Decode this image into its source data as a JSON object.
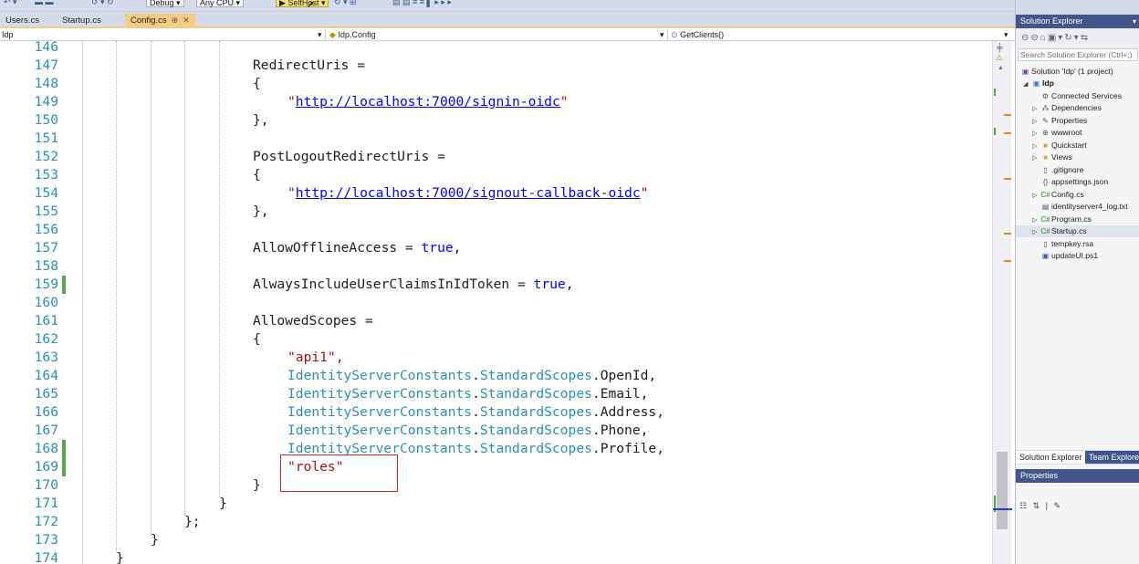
{
  "toolbar": {
    "config": "Debug",
    "platform": "Any CPU",
    "run_target": "SelfHost"
  },
  "tabs": [
    {
      "label": "Users.cs"
    },
    {
      "label": "Startup.cs"
    },
    {
      "label": "Config.cs",
      "pin": "⊕",
      "close": "✕"
    }
  ],
  "navbar": {
    "project": "Idp",
    "type": "Idp.Config",
    "member": "GetClients()"
  },
  "editor": {
    "lines": [
      {
        "n": "146",
        "text": ""
      },
      {
        "n": "147",
        "text": "RedirectUris ="
      },
      {
        "n": "148",
        "text": "{"
      },
      {
        "n": "149",
        "text": "\"http://localhost:7000/signin-oidc\""
      },
      {
        "n": "150",
        "text": "},"
      },
      {
        "n": "151",
        "text": ""
      },
      {
        "n": "152",
        "text": "PostLogoutRedirectUris ="
      },
      {
        "n": "153",
        "text": "{"
      },
      {
        "n": "154",
        "text": "\"http://localhost:7000/signout-callback-oidc\""
      },
      {
        "n": "155",
        "text": "},"
      },
      {
        "n": "156",
        "text": ""
      },
      {
        "n": "157",
        "text": "AllowOfflineAccess = true,"
      },
      {
        "n": "158",
        "text": ""
      },
      {
        "n": "159",
        "text": "AlwaysIncludeUserClaimsInIdToken = true,"
      },
      {
        "n": "160",
        "text": ""
      },
      {
        "n": "161",
        "text": "AllowedScopes ="
      },
      {
        "n": "162",
        "text": "{"
      },
      {
        "n": "163",
        "text": "\"api1\","
      },
      {
        "n": "164",
        "text": "IdentityServerConstants.StandardScopes.OpenId,"
      },
      {
        "n": "165",
        "text": "IdentityServerConstants.StandardScopes.Email,"
      },
      {
        "n": "166",
        "text": "IdentityServerConstants.StandardScopes.Address,"
      },
      {
        "n": "167",
        "text": "IdentityServerConstants.StandardScopes.Phone,"
      },
      {
        "n": "168",
        "text": "IdentityServerConstants.StandardScopes.Profile,"
      },
      {
        "n": "169",
        "text": "\"roles\""
      },
      {
        "n": "170",
        "text": "}"
      },
      {
        "n": "171",
        "text": "}"
      },
      {
        "n": "172",
        "text": "};"
      },
      {
        "n": "173",
        "text": "}"
      },
      {
        "n": "174",
        "text": "}"
      }
    ],
    "changed_lines": [
      "159",
      "168",
      "169"
    ],
    "highlighted_line": "169"
  },
  "solution_explorer": {
    "title": "Solution Explorer",
    "search_placeholder": "Search Solution Explorer (Ctrl+;)",
    "items": [
      {
        "label": "Solution 'Idp' (1 project)",
        "icon": "solution-icon"
      },
      {
        "label": "Idp",
        "icon": "project-icon"
      },
      {
        "label": "Connected Services",
        "icon": "connected-services-icon"
      },
      {
        "label": "Dependencies",
        "icon": "dependencies-icon"
      },
      {
        "label": "Properties",
        "icon": "wrench-icon"
      },
      {
        "label": "wwwroot",
        "icon": "globe-icon"
      },
      {
        "label": "Quickstart",
        "icon": "folder-icon"
      },
      {
        "label": "Views",
        "icon": "folder-icon"
      },
      {
        "label": ".gitignore",
        "icon": "file-icon"
      },
      {
        "label": "appsettings.json",
        "icon": "json-file-icon"
      },
      {
        "label": "Config.cs",
        "icon": "csharp-file-icon"
      },
      {
        "label": "identityserver4_log.txt",
        "icon": "text-file-icon"
      },
      {
        "label": "Program.cs",
        "icon": "csharp-file-icon"
      },
      {
        "label": "Startup.cs",
        "icon": "csharp-file-icon"
      },
      {
        "label": "tempkey.rsa",
        "icon": "file-icon"
      },
      {
        "label": "updateUI.ps1",
        "icon": "powershell-file-icon"
      }
    ],
    "selected": "Startup.cs",
    "bottom_tabs": [
      "Solution Explorer",
      "Team Explorer"
    ]
  },
  "properties": {
    "title": "Properties"
  }
}
